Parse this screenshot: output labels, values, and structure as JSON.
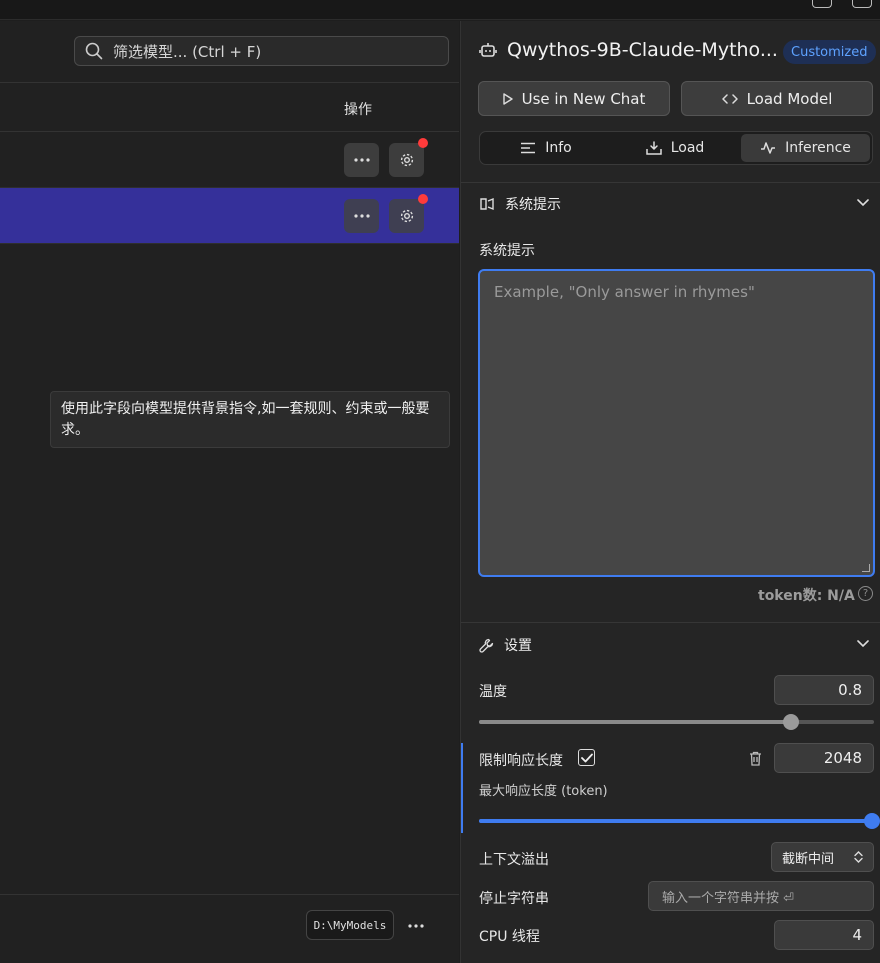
{
  "left": {
    "search": {
      "placeholder": "筛选模型... (Ctrl + F)"
    },
    "table": {
      "actions_header": "操作"
    },
    "tooltip": {
      "text": "使用此字段向模型提供背景指令,如一套规则、约束或一般要求。"
    },
    "footer": {
      "models_path": "D:\\MyModels"
    }
  },
  "right": {
    "model_name": "Qwythos-9B-Claude-Mytho...",
    "badge": "Customized",
    "use_new_chat": "Use in New Chat",
    "load_model": "Load Model",
    "tabs": [
      {
        "label": "Info"
      },
      {
        "label": "Load"
      },
      {
        "label": "Inference"
      }
    ],
    "system_prompt": {
      "section_title": "系统提示",
      "field_label": "系统提示",
      "placeholder": "Example, \"Only answer in rhymes\"",
      "token_count": "token数: N/A"
    },
    "settings": {
      "section_title": "设置",
      "temperature": {
        "label": "温度",
        "value": "0.8",
        "slider_fraction": 0.79
      },
      "limit_response": {
        "label": "限制响应长度",
        "checked": true,
        "value": "2048",
        "sub_label": "最大响应长度 (token)",
        "slider_fraction": 1.0
      },
      "context_overflow": {
        "label": "上下文溢出",
        "value": "截断中间"
      },
      "stop_strings": {
        "label": "停止字符串",
        "placeholder": "输入一个字符串并按 ⏎"
      },
      "cpu_threads": {
        "label": "CPU 线程",
        "value": "4"
      }
    }
  },
  "colors": {
    "accent": "#3f7cf0",
    "selected_row": "#35309a",
    "badge_text": "#5ea2ff",
    "notification_dot": "#ff3b3b"
  }
}
